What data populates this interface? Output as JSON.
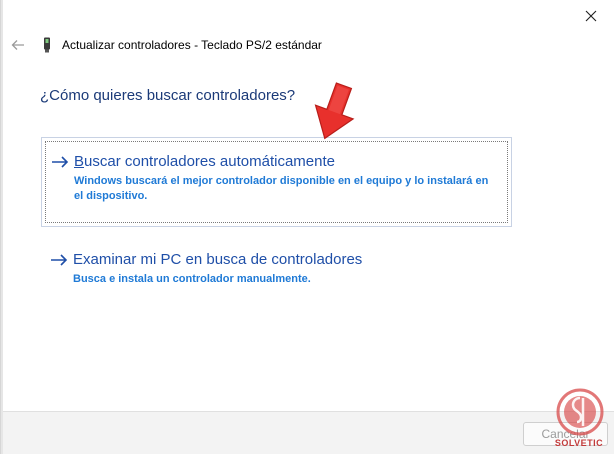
{
  "window": {
    "title": "Actualizar controladores - Teclado PS/2 estándar"
  },
  "question": "¿Cómo quieres buscar controladores?",
  "options": [
    {
      "title_underlined": "B",
      "title_rest": "uscar controladores automáticamente",
      "description": "Windows buscará el mejor controlador disponible en el equipo y lo instalará en el dispositivo."
    },
    {
      "title_underlined": "",
      "title_rest": "Examinar mi PC en busca de controladores",
      "description": "Busca e instala un controlador manualmente."
    }
  ],
  "footer": {
    "cancel_label": "Cancelar"
  },
  "watermark": {
    "text": "SOLVETIC"
  },
  "colors": {
    "question": "#1b3a78",
    "option_title": "#1f4fa8",
    "option_desc": "#1f7ad6",
    "pointer": "#e8302c"
  },
  "icons": {
    "close": "close-icon",
    "back": "back-arrow-icon",
    "device": "keyboard-device-icon",
    "option_arrow": "right-arrow-icon"
  }
}
